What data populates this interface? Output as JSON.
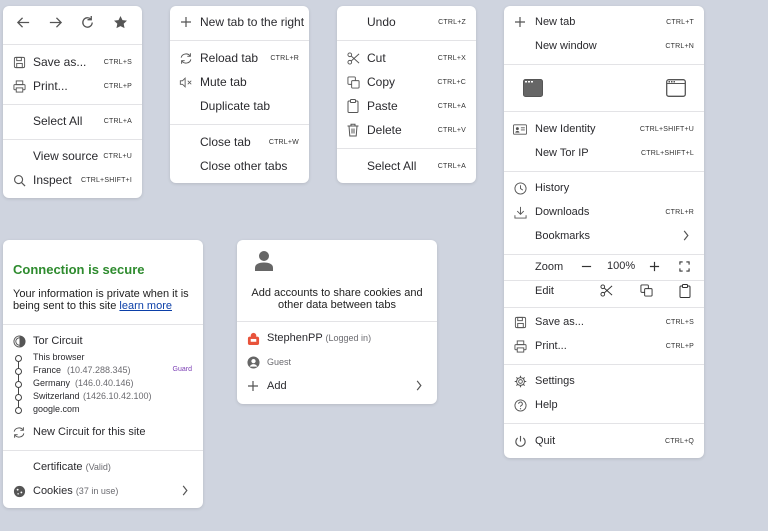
{
  "ctx_page": {
    "nav_icons": [
      "back-icon",
      "forward-icon",
      "reload-icon",
      "bookmark-star-icon"
    ],
    "save_as": "Save as...",
    "save_as_sc": "CTRL+S",
    "print": "Print...",
    "print_sc": "CTRL+P",
    "select_all": "Select All",
    "select_all_sc": "CTRL+A",
    "view_source": "View source",
    "view_source_sc": "CTRL+U",
    "inspect": "Inspect",
    "inspect_sc": "CTRL+SHIFT+I"
  },
  "ctx_tab": {
    "new_tab_right": "New tab to the right",
    "reload_tab": "Reload tab",
    "reload_tab_sc": "CTRL+R",
    "mute_tab": "Mute tab",
    "duplicate_tab": "Duplicate tab",
    "close_tab": "Close tab",
    "close_tab_sc": "CTRL+W",
    "close_other_tabs": "Close other tabs"
  },
  "ctx_edit": {
    "undo": "Undo",
    "undo_sc": "CTRL+Z",
    "cut": "Cut",
    "cut_sc": "CTRL+X",
    "copy": "Copy",
    "copy_sc": "CTRL+C",
    "paste": "Paste",
    "paste_sc": "CTRL+A",
    "delete": "Delete",
    "delete_sc": "CTRL+V",
    "select_all": "Select All",
    "select_all_sc": "CTRL+A"
  },
  "connection": {
    "title": "Connection is secure",
    "desc": "Your information is private when it is being sent to this site",
    "learn_more": "learn more",
    "circuit_title": "Tor Circuit",
    "nodes": [
      {
        "name": "This browser",
        "detail": "",
        "tag": ""
      },
      {
        "name": "France",
        "detail": "(10.47.288.345)",
        "tag": "Guard"
      },
      {
        "name": "Germany",
        "detail": "(146.0.40.146)",
        "tag": ""
      },
      {
        "name": "Switzerland",
        "detail": "(1426.10.42.100)",
        "tag": ""
      },
      {
        "name": "google.com",
        "detail": "",
        "tag": ""
      }
    ],
    "new_circuit": "New Circuit for this site",
    "certificate": "Certificate",
    "certificate_state": "(Valid)",
    "cookies": "Cookies",
    "cookies_state": "(37 in use)",
    "accent": "#2e8b2e"
  },
  "accounts": {
    "prompt": "Add accounts to share cookies and other data between tabs",
    "user": "StephenPP",
    "user_state": "(Logged in)",
    "guest": "Guest",
    "add": "Add"
  },
  "app_menu": {
    "new_tab": "New tab",
    "new_tab_sc": "CTRL+T",
    "new_window": "New window",
    "new_window_sc": "CTRL+N",
    "new_identity": "New Identity",
    "new_identity_sc": "CTRL+SHIFT+U",
    "new_tor_ip": "New Tor IP",
    "new_tor_ip_sc": "CTRL+SHIFT+L",
    "history": "History",
    "downloads": "Downloads",
    "downloads_sc": "CTRL+R",
    "bookmarks": "Bookmarks",
    "zoom": "Zoom",
    "zoom_value": "100%",
    "edit": "Edit",
    "save_as": "Save as...",
    "save_as_sc": "CTRL+S",
    "print": "Print...",
    "print_sc": "CTRL+P",
    "settings": "Settings",
    "help": "Help",
    "quit": "Quit",
    "quit_sc": "CTRL+Q"
  }
}
